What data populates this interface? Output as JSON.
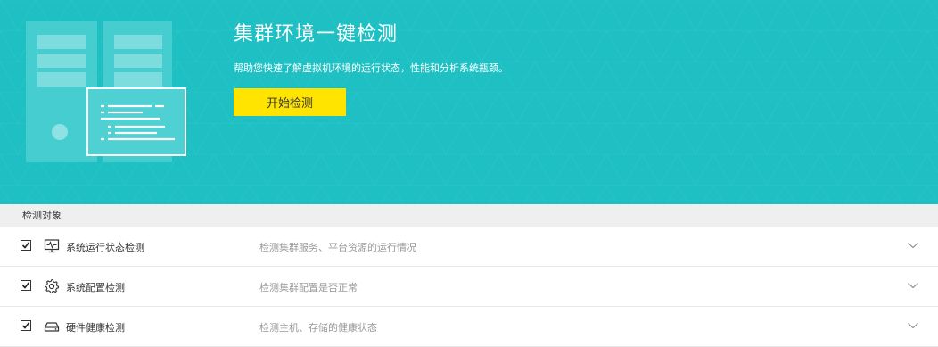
{
  "hero": {
    "title": "集群环境一键检测",
    "description": "帮助您快速了解虚拟机环境的运行状态，性能和分析系统瓶颈。",
    "start_button": "开始检测",
    "background_color": "#1ec0c3",
    "button_color": "#ffe400"
  },
  "section": {
    "header": "检测对象"
  },
  "items": [
    {
      "label": "系统运行状态检测",
      "description": "检测集群服务、平台资源的运行情况",
      "icon": "monitor-pulse-icon",
      "checked": true
    },
    {
      "label": "系统配置检测",
      "description": "检测集群配置是否正常",
      "icon": "gear-icon",
      "checked": true
    },
    {
      "label": "硬件健康检测",
      "description": "检测主机、存储的健康状态",
      "icon": "hard-drive-icon",
      "checked": true
    }
  ]
}
